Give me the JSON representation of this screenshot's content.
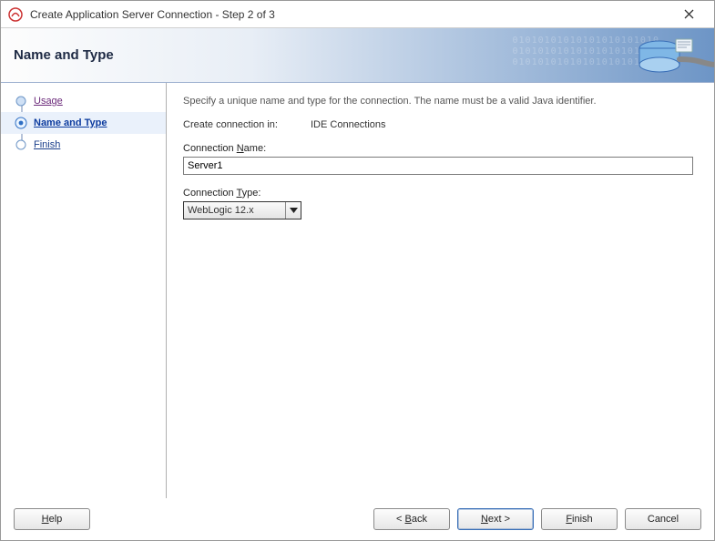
{
  "window": {
    "title": "Create Application Server Connection - Step 2 of 3"
  },
  "header": {
    "title": "Name and Type"
  },
  "sidebar": {
    "steps": [
      {
        "label": "Usage"
      },
      {
        "label": "Name and Type"
      },
      {
        "label": "Finish"
      }
    ]
  },
  "content": {
    "instruction": "Specify a unique name and type for the connection. The name must be a valid Java identifier.",
    "create_in_label": "Create connection in:",
    "create_in_value": "IDE Connections",
    "conn_name_prefix": "Connection ",
    "conn_name_hot": "N",
    "conn_name_suffix": "ame:",
    "conn_name_value": "Server1",
    "conn_type_prefix": "Connection ",
    "conn_type_hot": "T",
    "conn_type_suffix": "ype:",
    "conn_type_value": "WebLogic 12.x"
  },
  "footer": {
    "help_hot": "H",
    "help_rest": "elp",
    "back_lt": "< ",
    "back_hot": "B",
    "back_rest": "ack",
    "next_hot": "N",
    "next_rest": "ext >",
    "finish_hot": "F",
    "finish_rest": "inish",
    "cancel": "Cancel"
  }
}
